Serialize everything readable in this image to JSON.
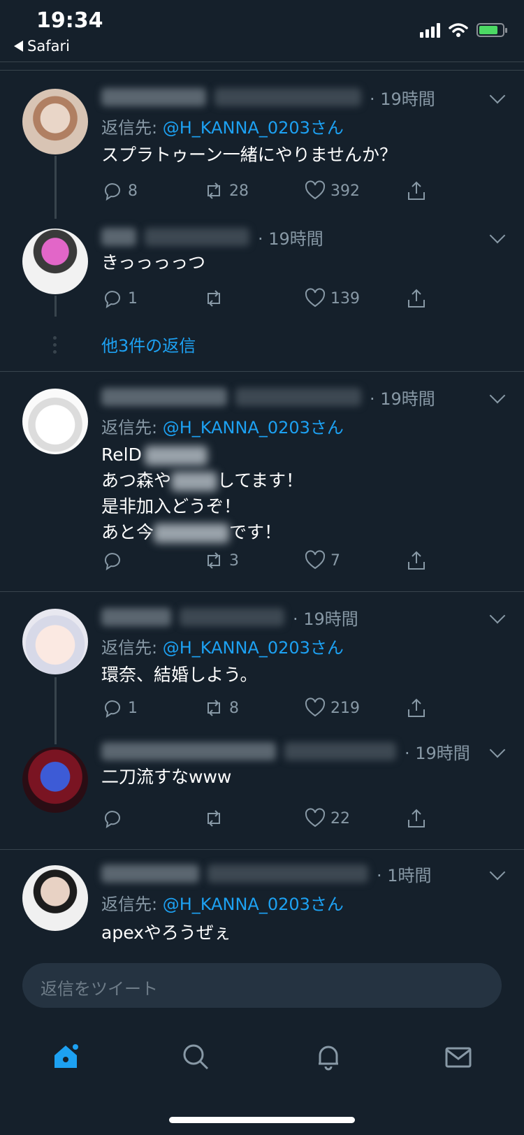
{
  "status_bar": {
    "time": "19:34",
    "back_app": "Safari",
    "battery_level": 0.8
  },
  "colors": {
    "background": "#15202b",
    "accent": "#1da1f2",
    "muted": "#8899a6",
    "divider": "#38444d"
  },
  "tweets": [
    {
      "time": "· 19時間",
      "reply_prefix": "返信先: ",
      "reply_handle": "@H_KANNA_0203さん",
      "text": "スプラトゥーン一緒にやりませんか？",
      "replies": "8",
      "retweets": "28",
      "likes": "392"
    },
    {
      "time": "· 19時間",
      "text": "きっっっっつ",
      "replies": "1",
      "retweets": "",
      "likes": "139"
    },
    {
      "time": "· 19時間",
      "reply_prefix": "返信先: ",
      "reply_handle": "@H_KANNA_0203さん",
      "text_line1": "RelD",
      "text_line2a": "あつ森や",
      "text_line2b": "してます！",
      "text_line3": "是非加入どうぞ！",
      "text_line4a": "あと今",
      "text_line4b": "です！",
      "replies": "",
      "retweets": "3",
      "likes": "7"
    },
    {
      "time": "· 19時間",
      "reply_prefix": "返信先: ",
      "reply_handle": "@H_KANNA_0203さん",
      "text": "環奈、結婚しよう。",
      "replies": "1",
      "retweets": "8",
      "likes": "219"
    },
    {
      "time": "· 19時間",
      "text": "二刀流すなwww",
      "replies": "",
      "retweets": "",
      "likes": "22"
    },
    {
      "time": "· 1時間",
      "reply_prefix": "返信先: ",
      "reply_handle": "@H_KANNA_0203さん",
      "text": "apexやろうぜぇ"
    }
  ],
  "more_replies": "他3件の返信",
  "composer": {
    "placeholder": "返信をツイート"
  },
  "tabbar": [
    "home-icon",
    "search-icon",
    "notifications-icon",
    "messages-icon"
  ]
}
